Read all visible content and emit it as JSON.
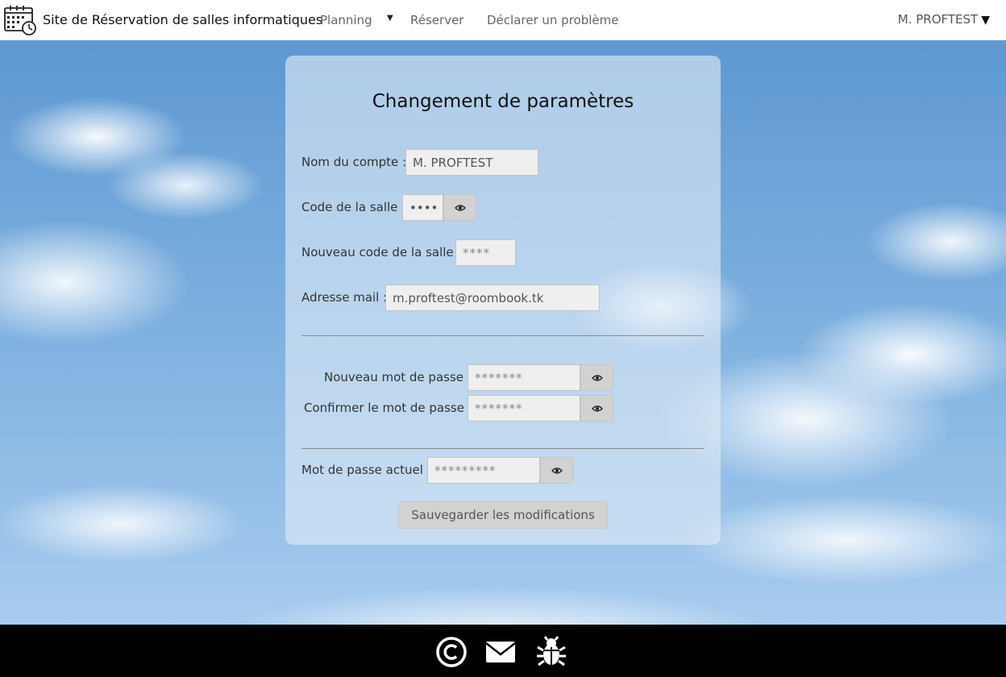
{
  "header": {
    "site_title": "Site de Réservation de salles informatiques",
    "nav": {
      "planning": "Planning",
      "reserver": "Réserver",
      "declarer": "Déclarer un problème"
    },
    "user": "M. PROFTEST",
    "user_caret": "▼",
    "planning_caret": "▼"
  },
  "form": {
    "title": "Changement de paramètres",
    "account_label": "Nom du compte :",
    "account_value": "M. PROFTEST",
    "room_code_label": "Code de la salle :",
    "room_code_value": "••••",
    "new_room_code_label": "Nouveau code de la salle :",
    "new_room_code_placeholder": "****",
    "email_label": "Adresse mail :",
    "email_value": "m.proftest@roombook.tk",
    "new_password_label": "Nouveau mot de passe :",
    "new_password_placeholder": "*******",
    "confirm_password_label": "Confirmer le mot de passe :",
    "confirm_password_placeholder": "*******",
    "current_password_label": "Mot de passe actuel :",
    "current_password_placeholder": "*********",
    "save_button": "Sauvegarder les modifications"
  },
  "footer": {
    "icons": [
      "copyright-icon",
      "mail-icon",
      "bug-icon"
    ]
  }
}
